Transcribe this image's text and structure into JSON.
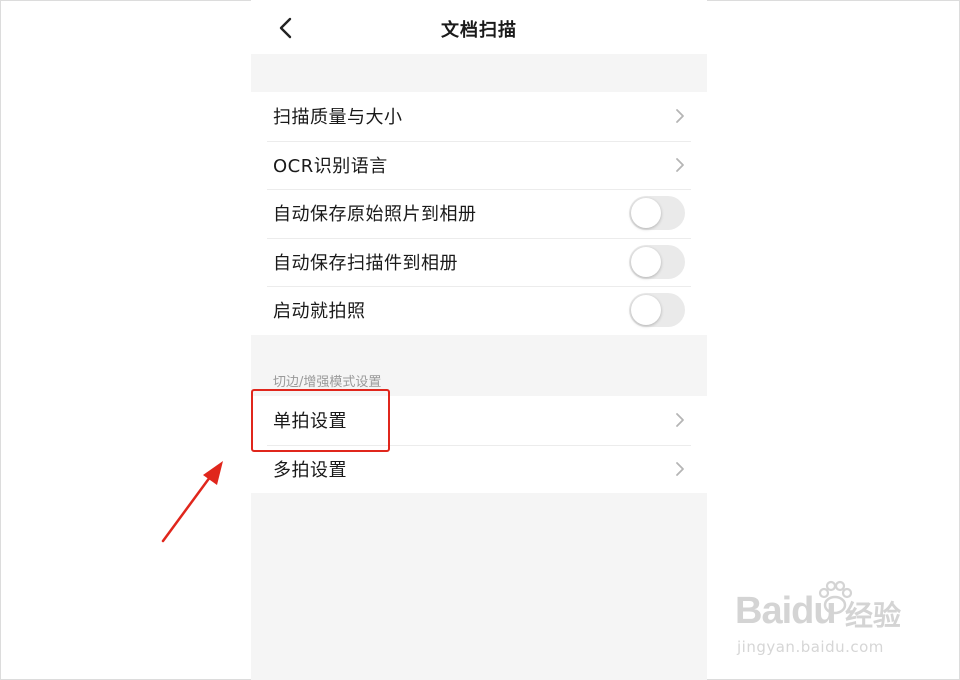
{
  "header": {
    "title": "文档扫描"
  },
  "settings_group_1": [
    {
      "label": "扫描质量与大小",
      "control": "chevron"
    },
    {
      "label": "OCR识别语言",
      "control": "chevron"
    },
    {
      "label": "自动保存原始照片到相册",
      "control": "toggle",
      "on": false
    },
    {
      "label": "自动保存扫描件到相册",
      "control": "toggle",
      "on": false
    },
    {
      "label": "启动就拍照",
      "control": "toggle",
      "on": false
    }
  ],
  "section_2": {
    "header": "切边/增强模式设置",
    "items": [
      {
        "label": "单拍设置",
        "control": "chevron",
        "highlighted": true
      },
      {
        "label": "多拍设置",
        "control": "chevron"
      }
    ]
  },
  "annotation": {
    "highlight_color": "#e0261c"
  },
  "watermark": {
    "brand": "Baidu",
    "brand_cn": "经验",
    "url": "jingyan.baidu.com"
  }
}
